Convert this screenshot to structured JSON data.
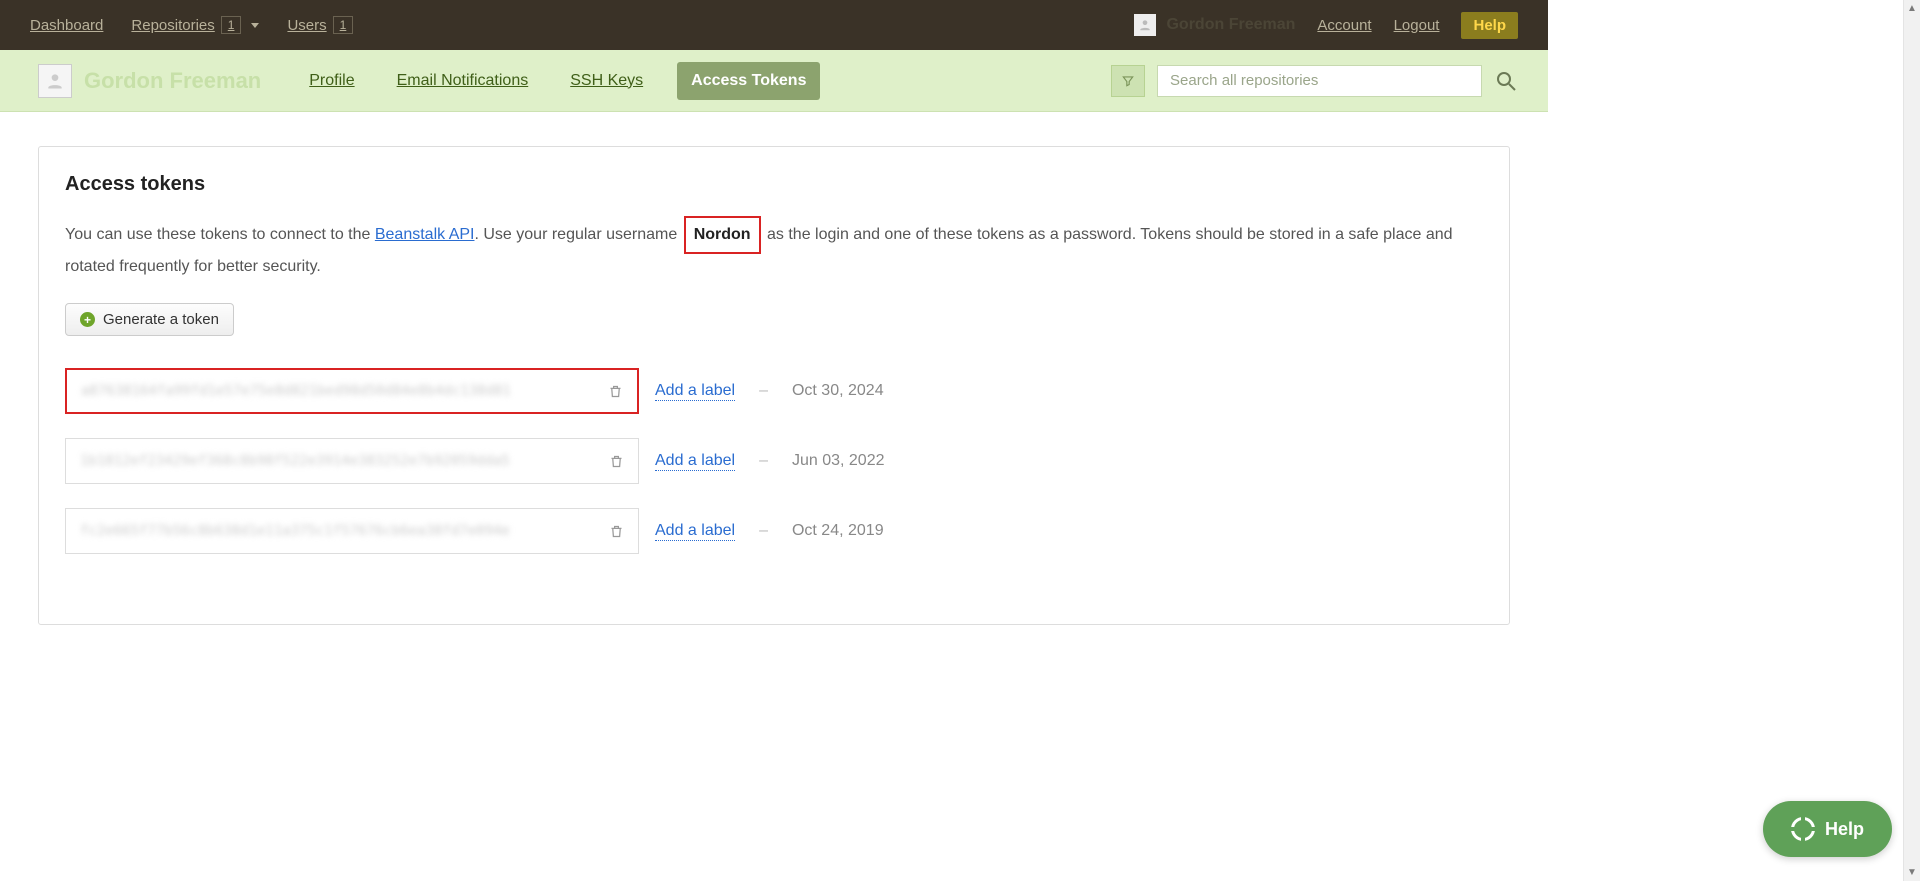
{
  "topbar": {
    "dashboard": "Dashboard",
    "repositories": {
      "label": "Repositories",
      "count": "1"
    },
    "users": {
      "label": "Users",
      "count": "1"
    },
    "user_ghost_name": "Gordon Freeman",
    "account": "Account",
    "logout": "Logout",
    "help": "Help"
  },
  "subbar": {
    "name": "Gordon Freeman",
    "tabs": {
      "profile": "Profile",
      "email_notifications": "Email Notifications",
      "ssh_keys": "SSH Keys",
      "access_tokens": "Access Tokens"
    },
    "search_placeholder": "Search all repositories"
  },
  "page": {
    "heading": "Access tokens",
    "intro_before_link": "You can use these tokens to connect to the ",
    "api_link": "Beanstalk API",
    "intro_after_link": ". Use your regular username ",
    "username": "Nordon",
    "intro_after_username": " as the login and one of these tokens as a password. Tokens should be stored in a safe place and rotated frequently for better security.",
    "generate_button": "Generate a token",
    "add_label_text": "Add a label",
    "separator": "–",
    "tokens": [
      {
        "value": "a87638164fa99fd1e57e75e8d821bed98d50d84e8b4dc138d81",
        "date": "Oct 30, 2024",
        "highlighted": true
      },
      {
        "value": "1b1812ef23429ef368c8b98f522e3914e383252e7b92059dda5",
        "date": "Jun 03, 2022",
        "highlighted": false
      },
      {
        "value": "fc2e665f77b56c8b638d1e11a375c1f57676cb6ea38fd7e094e",
        "date": "Oct 24, 2019",
        "highlighted": false
      }
    ]
  },
  "help_fab": "Help"
}
